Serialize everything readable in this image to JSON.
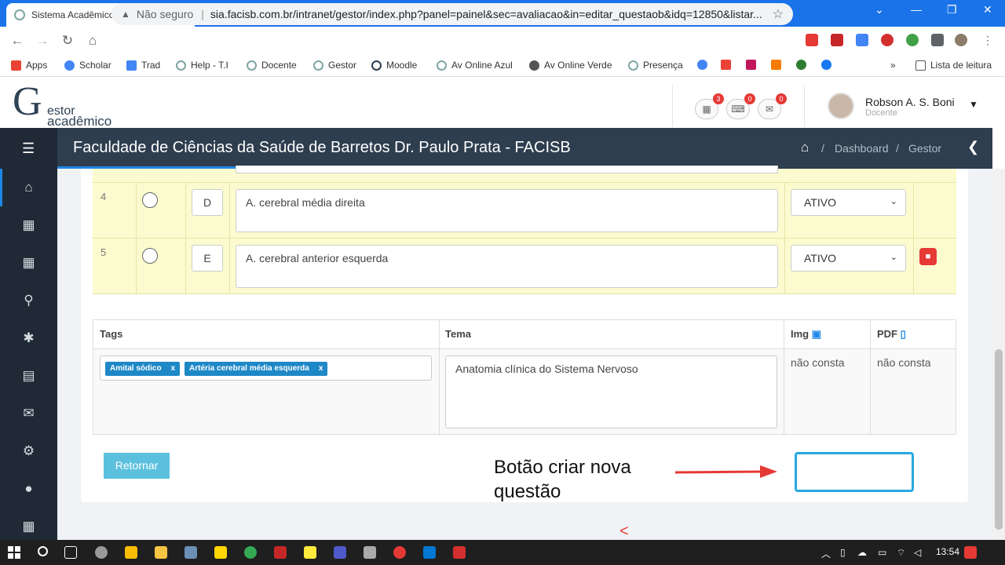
{
  "browser": {
    "tab_title": "Sistema Acadêmico | FACISB",
    "security_label": "Não seguro",
    "url": "sia.facisb.com.br/intranet/gestor/index.php?panel=painel&sec=avaliacao&in=editar_questaob&idq=12850&listar...",
    "bookmarks": [
      "Apps",
      "Scholar",
      "Trad",
      "Help - T.I",
      "Docente",
      "Gestor",
      "Moodle",
      "Av Online Azul",
      "Av Online Verde",
      "Presença"
    ],
    "reading_list": "Lista de leitura",
    "more": "»"
  },
  "header": {
    "logo_letter": "G",
    "logo_line1": "estor",
    "logo_line2": "acadêmico",
    "badges": {
      "calendar": "3",
      "keyboard": "0",
      "mail": "0"
    },
    "user_name": "Robson A. S. Boni",
    "user_role": "Docente"
  },
  "navbar": {
    "title": "Faculdade de Ciências da Saúde de Barretos Dr. Paulo Prata - FACISB",
    "breadcrumb": [
      "Dashboard",
      "Gestor"
    ],
    "breadcrumb_sep": "/"
  },
  "alternatives": [
    {
      "number": "4",
      "letter": "D",
      "text": "A. cerebral média direita",
      "status": "ATIVO"
    },
    {
      "number": "5",
      "letter": "E",
      "text": "A. cerebral anterior esquerda",
      "status": "ATIVO"
    }
  ],
  "meta": {
    "headers": {
      "tags": "Tags",
      "tema": "Tema",
      "img": "Img",
      "pdf": "PDF"
    },
    "tags": [
      "Amital sódico",
      "Artéria cerebral média esquerda"
    ],
    "tag_remove": "x",
    "tema": "Anatomia clínica do Sistema Nervoso",
    "img_value": "não consta",
    "pdf_value": "não consta"
  },
  "actions": {
    "return_label": "Retornar"
  },
  "annotation": {
    "line1": "Botão criar nova",
    "line2": "questão"
  },
  "taskbar": {
    "clock": "13:54"
  },
  "colors": {
    "brand_blue": "#1a73e8",
    "nav_dark": "#2e3e4f",
    "sidebar_dark": "#1f2a36",
    "alt_row_bg": "#fcfbcf",
    "tag_blue": "#1e88c7",
    "button_info": "#5bc0de",
    "delete_red": "#e53935"
  }
}
